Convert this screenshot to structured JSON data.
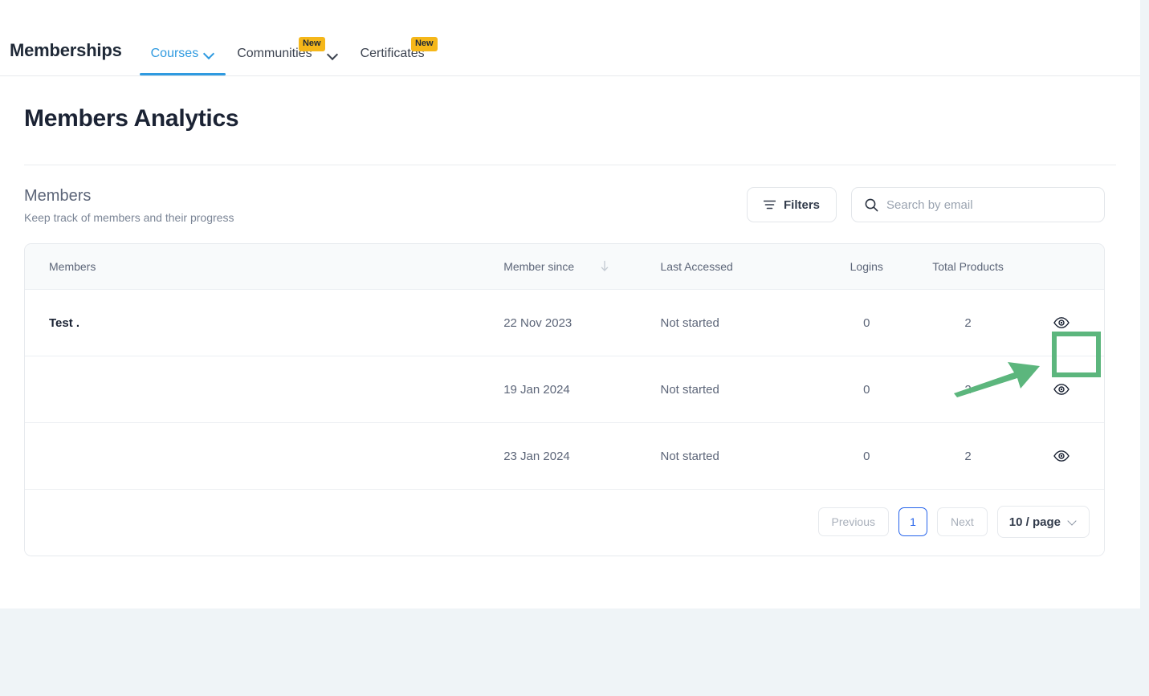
{
  "nav": {
    "brand": "Memberships",
    "tabs": [
      {
        "label": "Courses",
        "active": true,
        "has_chevron": true,
        "badge": ""
      },
      {
        "label": "Communities",
        "active": false,
        "has_chevron": false,
        "badge": "New"
      },
      {
        "label": "Certificates",
        "active": false,
        "has_chevron": false,
        "badge": "New"
      }
    ],
    "standalone_chevron": "chevron-down-icon"
  },
  "page": {
    "title": "Members Analytics"
  },
  "section": {
    "title": "Members",
    "subtitle": "Keep track of members and their progress"
  },
  "toolbar": {
    "filters_label": "Filters",
    "filters_icon": "filter-icon",
    "search_icon": "search-icon",
    "search_placeholder": "Search by email",
    "search_value": ""
  },
  "table": {
    "columns": [
      {
        "key": "members",
        "label": "Members"
      },
      {
        "key": "since",
        "label": "Member since",
        "sort": "desc",
        "sort_icon": "arrow-down-icon"
      },
      {
        "key": "last",
        "label": "Last Accessed"
      },
      {
        "key": "logins",
        "label": "Logins"
      },
      {
        "key": "total",
        "label": "Total Products"
      },
      {
        "key": "action",
        "label": ""
      }
    ],
    "rows": [
      {
        "members": "Test .",
        "since": "22 Nov 2023",
        "last": "Not started",
        "logins": "0",
        "total": "2",
        "action_icon": "eye-icon"
      },
      {
        "members": "",
        "since": "19 Jan 2024",
        "last": "Not started",
        "logins": "0",
        "total": "2",
        "action_icon": "eye-icon"
      },
      {
        "members": "",
        "since": "23 Jan 2024",
        "last": "Not started",
        "logins": "0",
        "total": "2",
        "action_icon": "eye-icon"
      }
    ]
  },
  "pagination": {
    "previous_label": "Previous",
    "current_page": "1",
    "next_label": "Next",
    "page_size_label": "10 / page"
  },
  "annotation": {
    "highlight_color": "#5cb67d",
    "target": "view-member-eye-button",
    "arrow_icon": "arrow-pointer"
  },
  "colors": {
    "accent_blue": "#2f9ae0",
    "badge_yellow": "#f5b719",
    "active_page_blue": "#2563eb",
    "page_background": "#eff4f7",
    "annotation_green": "#5cb67d"
  }
}
